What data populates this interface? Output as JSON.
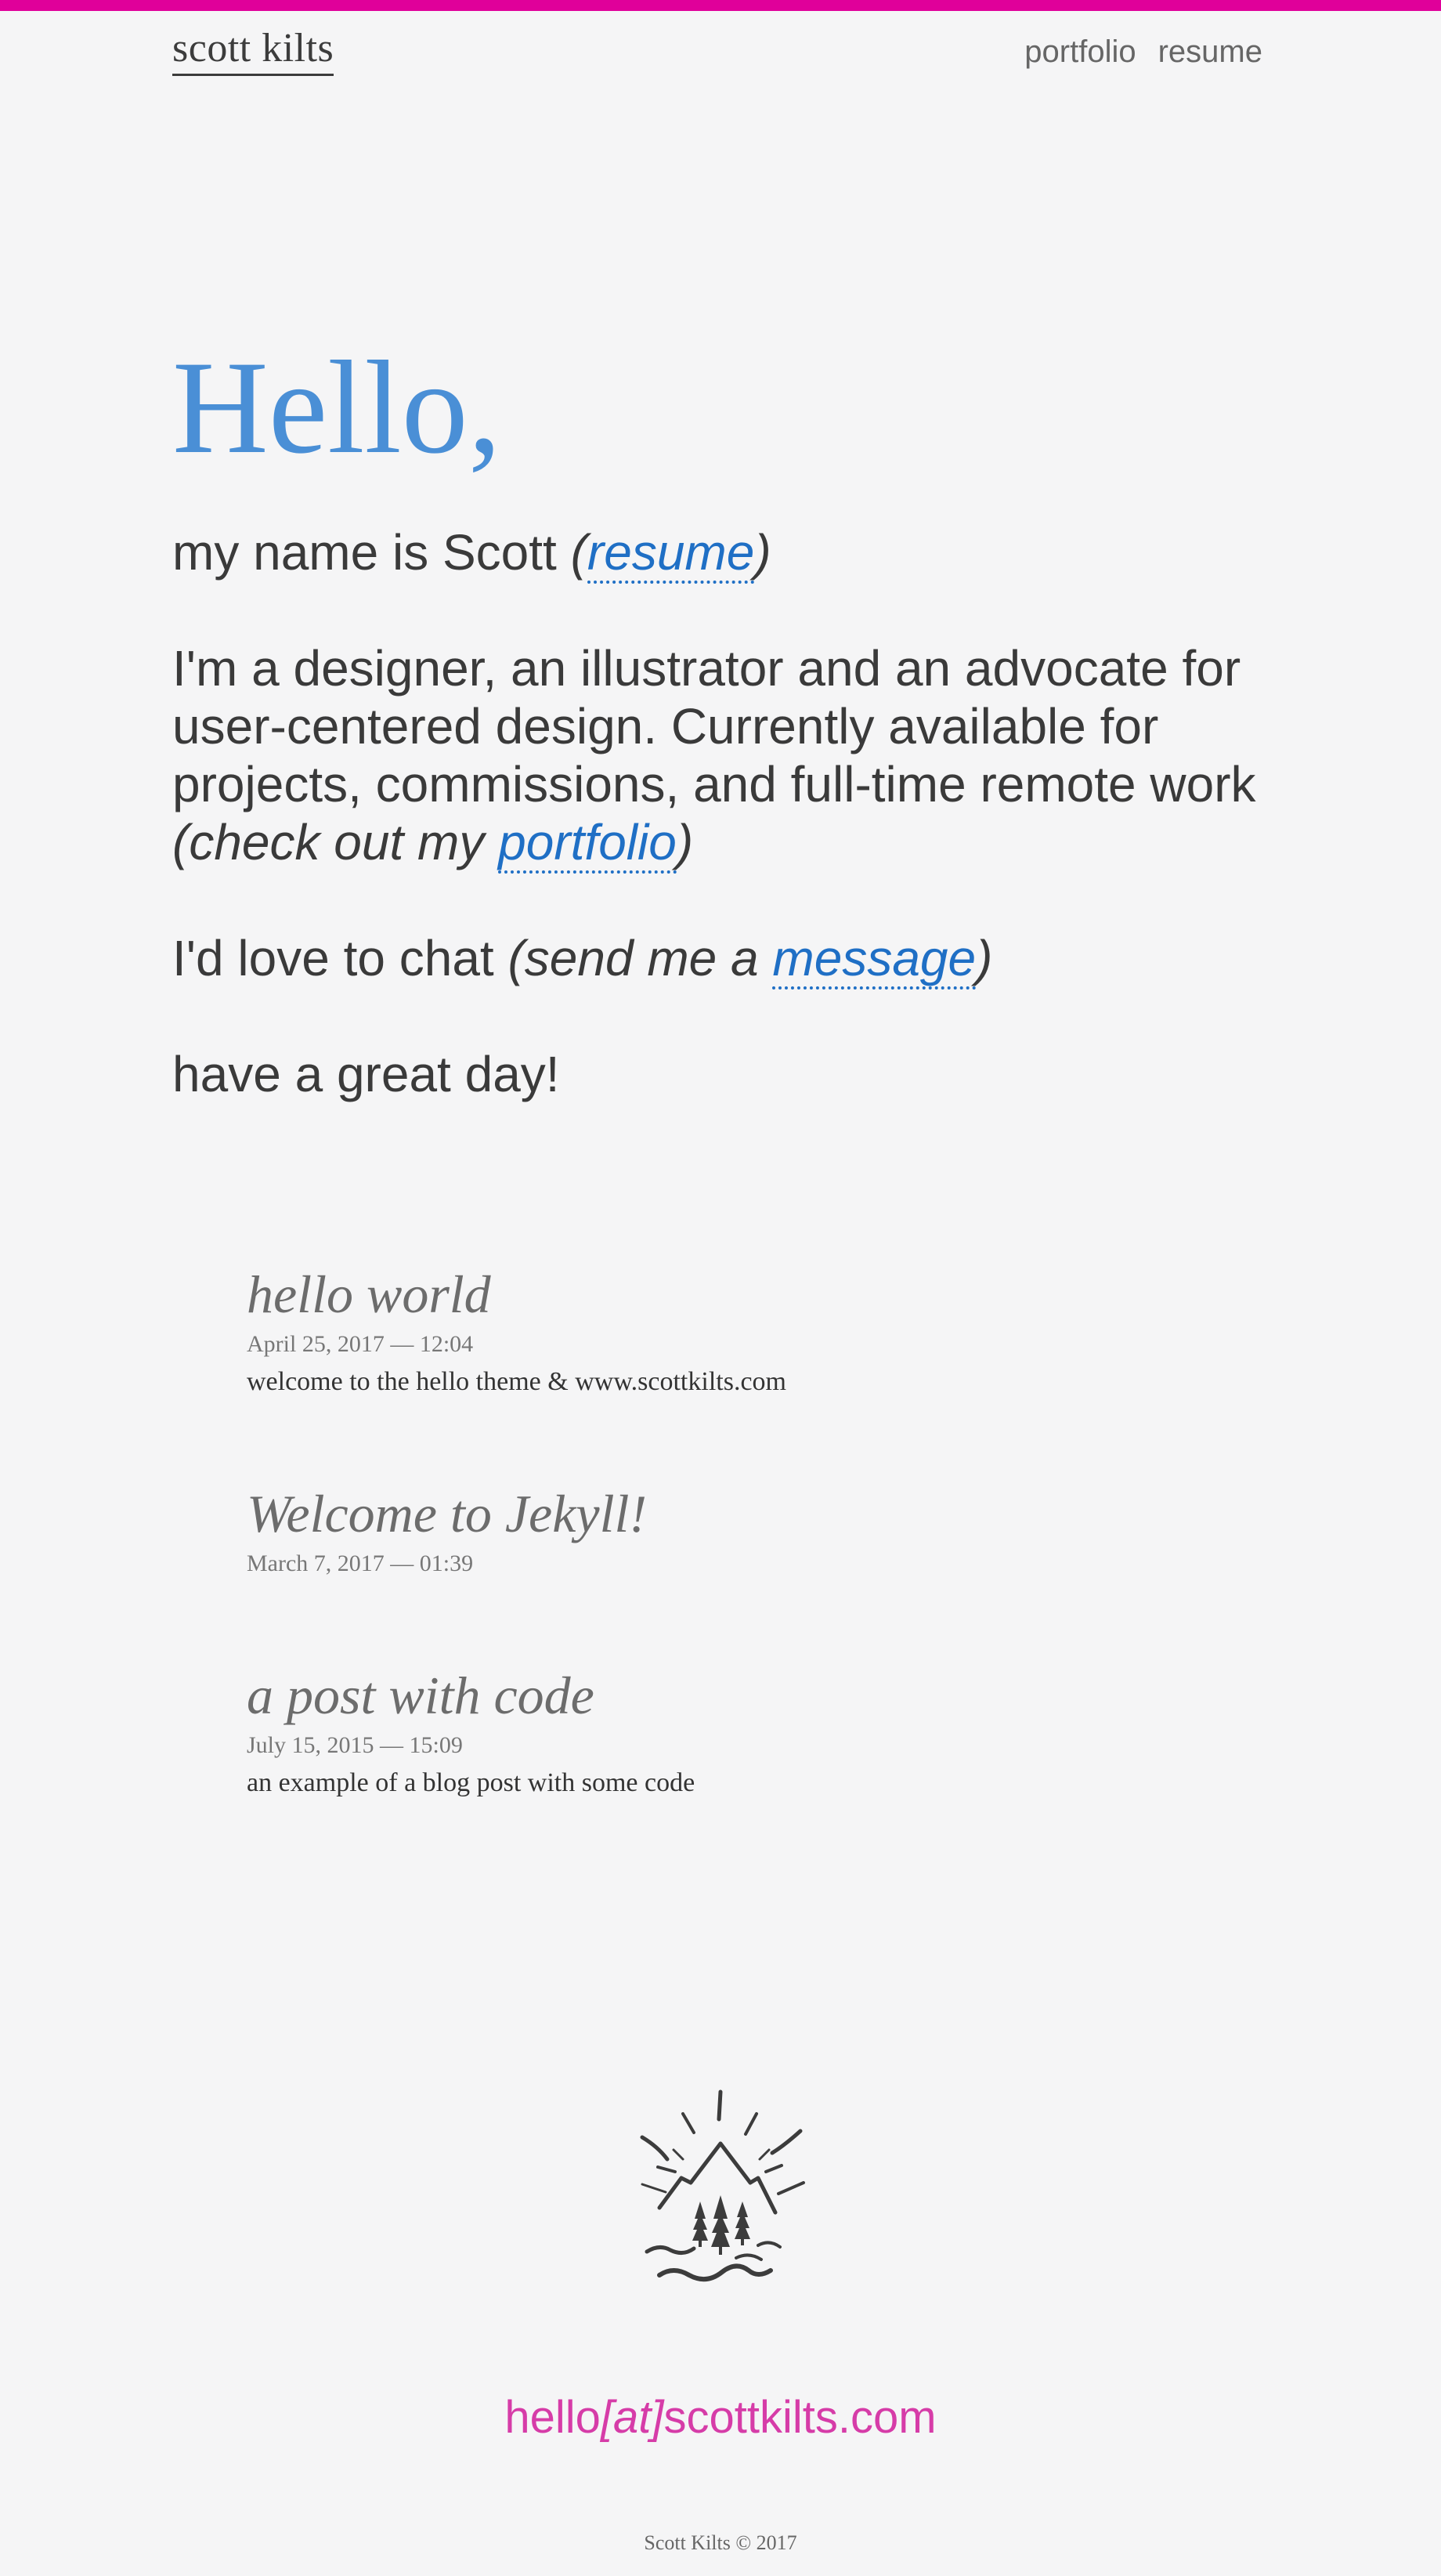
{
  "brand": {
    "accent_color": "#e0009a",
    "link_color": "#1f6fc5",
    "hello_color": "#4a8fd6",
    "email_color": "#d63ca8"
  },
  "header": {
    "site_title": "scott kilts",
    "nav": [
      {
        "label": "portfolio"
      },
      {
        "label": "resume"
      }
    ]
  },
  "hero": {
    "greeting": "Hello,",
    "line1_text": "my name is Scott ",
    "line1_open": "(",
    "line1_link": "resume",
    "line1_close": ")",
    "line2_text": "I'm a designer, an illustrator and an advocate for user-centered design. Currently available for projects, commissions, and full-time remote work ",
    "line2_aside": "(check out my ",
    "line2_link": "portfolio",
    "line2_close": ")",
    "line3_text": "I'd love to chat ",
    "line3_aside": "(send me a ",
    "line3_link": "message",
    "line3_close": ")",
    "line4_text": "have a great day!"
  },
  "posts": [
    {
      "title": "hello world",
      "date": "April 25, 2017 — 12:04",
      "excerpt": "welcome to the hello theme & www.scottkilts.com"
    },
    {
      "title": "Welcome to Jekyll!",
      "date": "March 7, 2017 — 01:39",
      "excerpt": ""
    },
    {
      "title": "a post with code",
      "date": "July 15, 2015 — 15:09",
      "excerpt": "an example of a blog post with some code"
    }
  ],
  "footer": {
    "logo_icon": "mountain-sun-trees-logo-icon",
    "email_prefix": "hello",
    "email_at": "[at]",
    "email_domain": "scottkilts.com",
    "copyright": "Scott Kilts © 2017"
  }
}
